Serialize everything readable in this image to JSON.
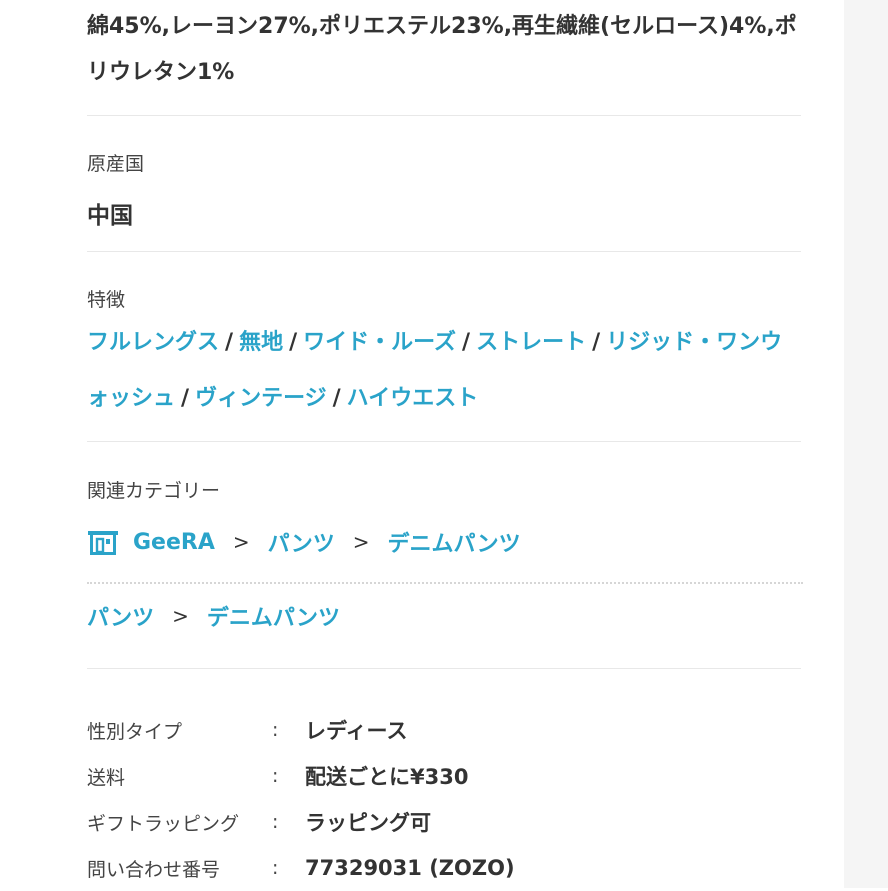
{
  "material": {
    "text": "綿45%,レーヨン27%,ポリエステル23%,再生繊維(セルロース)4%,ポリウレタン1%"
  },
  "origin": {
    "label": "原産国",
    "value": "中国"
  },
  "features": {
    "label": "特徴",
    "separator": "/",
    "items": [
      "フルレングス",
      "無地",
      "ワイド・ルーズ",
      "ストレート",
      "リジッド・ワンウォッシュ",
      "ヴィンテージ",
      "ハイウエスト"
    ]
  },
  "categories": {
    "label": "関連カテゴリー",
    "arrow": ">",
    "shop_icon": "shop-icon",
    "shop_path": [
      "GeeRA",
      "パンツ",
      "デニムパンツ"
    ],
    "general_path": [
      "パンツ",
      "デニムパンツ"
    ]
  },
  "specs": {
    "colon": ":",
    "rows": [
      {
        "key": "性別タイプ",
        "value": "レディース"
      },
      {
        "key": "送料",
        "value": "配送ごとに¥330"
      },
      {
        "key": "ギフトラッピング",
        "value": "ラッピング可"
      },
      {
        "key": "問い合わせ番号",
        "value": "77329031 (ZOZO)"
      }
    ]
  },
  "colors": {
    "link": "#2aa3c9",
    "text": "#333333",
    "divider": "#e8e8e8"
  }
}
